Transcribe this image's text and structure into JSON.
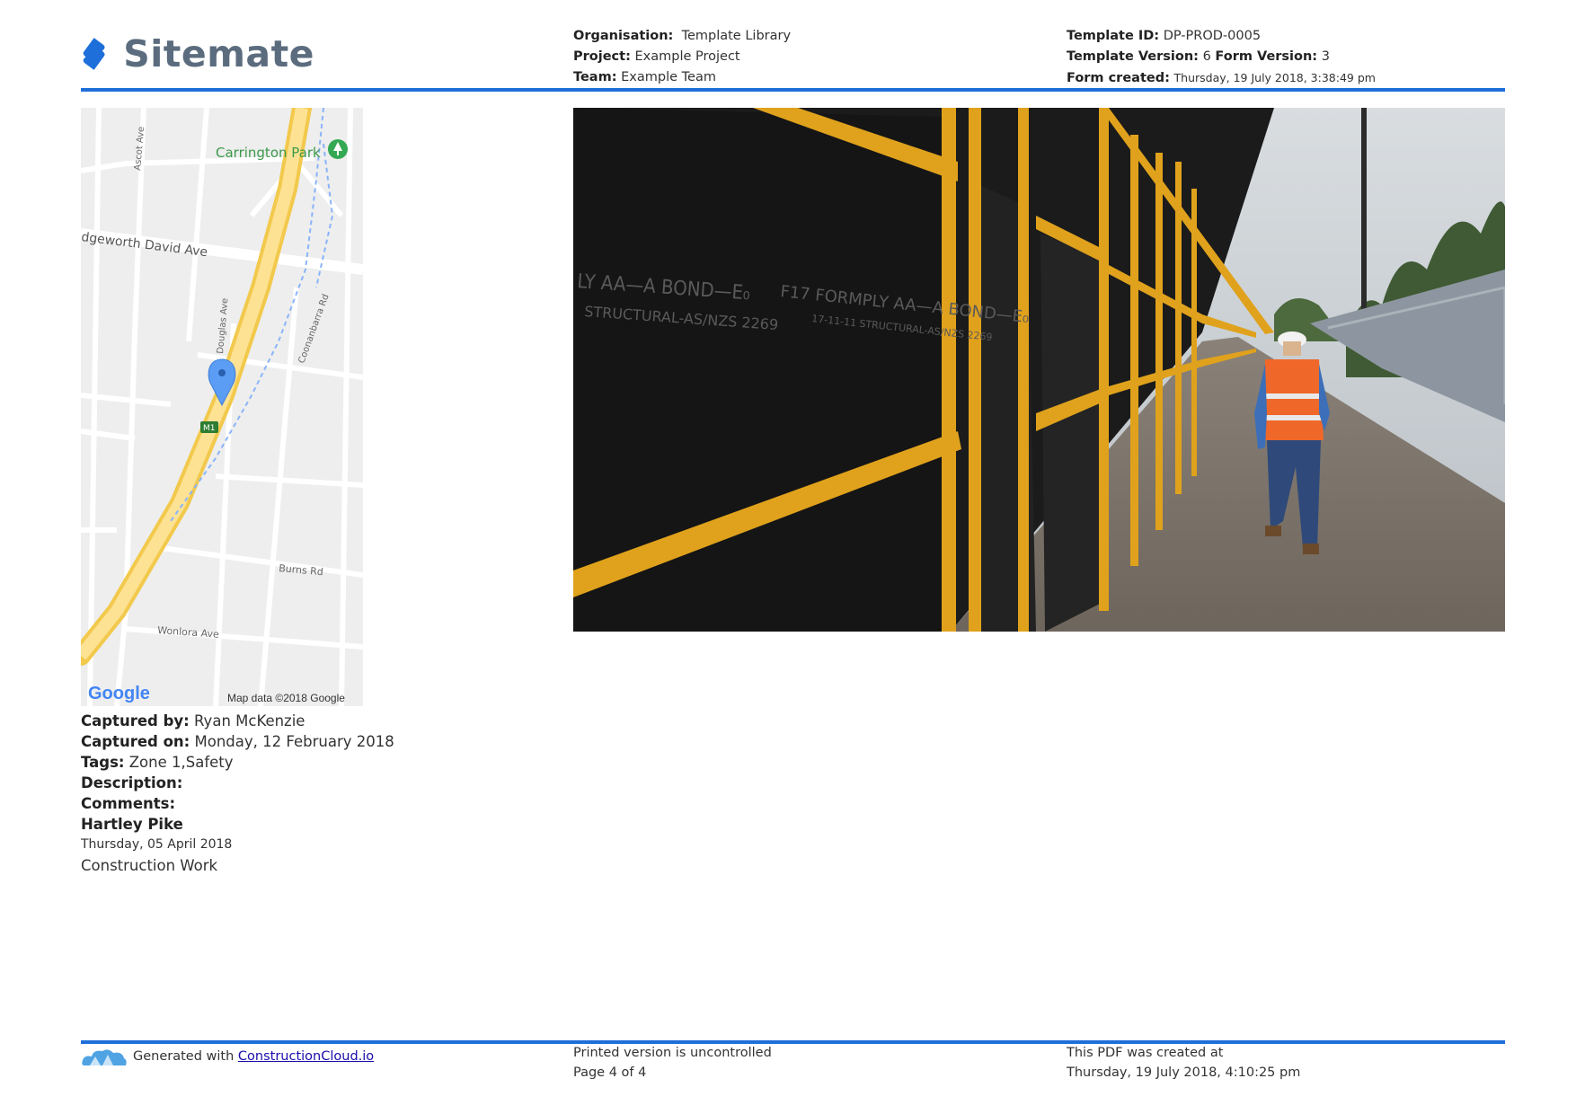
{
  "header": {
    "logo_text": "Sitemate",
    "organisation_label": "Organisation:",
    "organisation_value": "Template Library",
    "project_label": "Project:",
    "project_value": "Example Project",
    "team_label": "Team:",
    "team_value": "Example Team",
    "template_id_label": "Template ID:",
    "template_id_value": "DP-PROD-0005",
    "template_version_label": "Template Version:",
    "template_version_value": "6",
    "form_version_label": "Form Version:",
    "form_version_value": "3",
    "form_created_label": "Form created:",
    "form_created_value": "Thursday, 19 July 2018, 3:38:49 pm"
  },
  "map": {
    "labels": {
      "park": "Carrington Park",
      "edgeworth": "dgeworth David Ave",
      "ascot": "Ascot Ave",
      "douglas": "Douglas Ave",
      "coonanbarra": "Coonanbarra Rd",
      "burns": "Burns Rd",
      "wonlora": "Wonlora Ave",
      "motorway": "M1",
      "google": "Google",
      "attribution": "Map data ©2018 Google"
    },
    "pin_icon": "map-pin-icon",
    "park_icon": "tree-icon"
  },
  "photo": {
    "board_text_1": "LY AA—A BOND—E₀",
    "board_text_2": "STRUCTURAL-AS/NZS 2269",
    "board_text_3": "F17 FORMPLY AA—A BOND—E₀",
    "board_text_4": "17-11-11 STRUCTURAL-AS/NZS 2269"
  },
  "capture": {
    "captured_by_label": "Captured by:",
    "captured_by_value": "Ryan McKenzie",
    "captured_on_label": "Captured on:",
    "captured_on_value": "Monday, 12 February 2018",
    "tags_label": "Tags:",
    "tags_value": "Zone 1,Safety",
    "description_label": "Description:",
    "comments_label": "Comments:",
    "comment_author": "Hartley Pike",
    "comment_date": "Thursday, 05 April 2018",
    "comment_text": "Construction Work"
  },
  "footer": {
    "generated_text": "Generated with",
    "generated_link": "ConstructionCloud.io",
    "uncontrolled_text": "Printed version is uncontrolled",
    "page_text": "Page 4 of 4",
    "pdf_created_text": "This PDF was created at",
    "pdf_created_value": "Thursday, 19 July 2018, 4:10:25 pm"
  },
  "colors": {
    "accent_rule": "#1e6fd9",
    "logo_blue": "#1e6fd9",
    "logo_text": "#5b6c7e"
  }
}
